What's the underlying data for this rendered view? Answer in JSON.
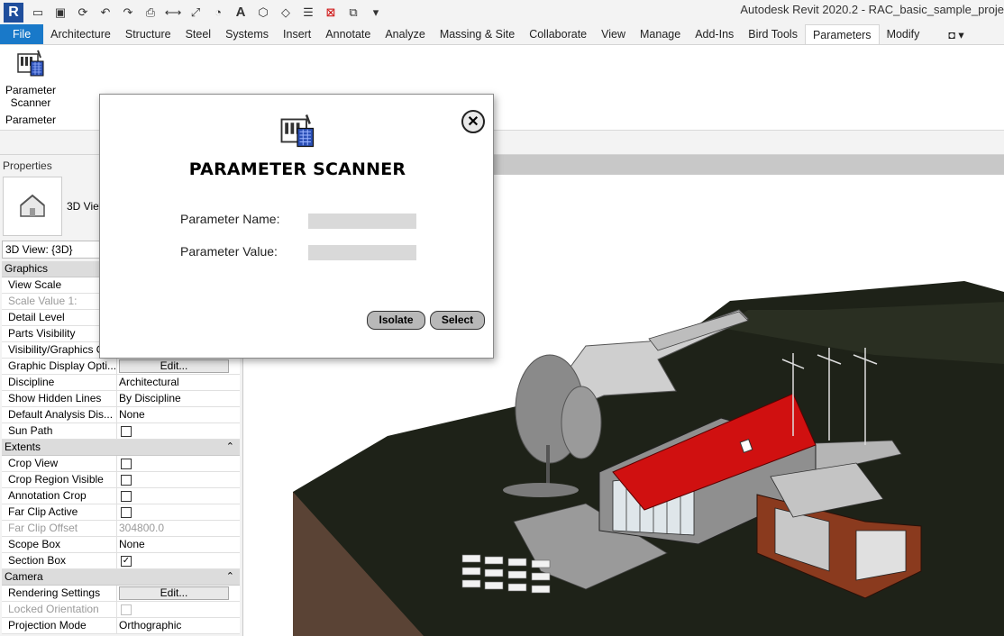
{
  "app": {
    "logo_letter": "R",
    "window_title": "Autodesk Revit 2020.2 - RAC_basic_sample_proje"
  },
  "quick_access": {
    "icons": [
      "open-icon",
      "save-icon",
      "sync-icon",
      "undo-icon",
      "redo-icon",
      "print-icon",
      "measure-icon",
      "dimension-icon",
      "tag-icon",
      "text-icon",
      "3d-view-icon",
      "section-icon",
      "thin-lines-icon",
      "close-hidden-icon",
      "switch-windows-icon",
      "customize-icon"
    ]
  },
  "ribbon_tabs": [
    "File",
    "Architecture",
    "Structure",
    "Steel",
    "Systems",
    "Insert",
    "Annotate",
    "Analyze",
    "Massing & Site",
    "Collaborate",
    "View",
    "Manage",
    "Add-Ins",
    "Bird Tools",
    "Parameters",
    "Modify"
  ],
  "active_tab": "Parameters",
  "ribbon_panel": {
    "tool_label": "Parameter Scanner",
    "panel_title": "Parameter"
  },
  "properties": {
    "title": "Properties",
    "type_name": "3D View",
    "selector": "3D View: {3D}",
    "rows": [
      {
        "kind": "group",
        "name": "Graphics",
        "collapse": ""
      },
      {
        "kind": "row",
        "name": "View Scale",
        "value": ""
      },
      {
        "kind": "row",
        "name": "Scale Value    1:",
        "value": "",
        "disabled": true
      },
      {
        "kind": "row",
        "name": "Detail Level",
        "value": ""
      },
      {
        "kind": "row",
        "name": "Parts Visibility",
        "value": ""
      },
      {
        "kind": "row",
        "name": "Visibility/Graphics O",
        "value": ""
      },
      {
        "kind": "button",
        "name": "Graphic Display Opti...",
        "value": "Edit..."
      },
      {
        "kind": "row",
        "name": "Discipline",
        "value": "Architectural"
      },
      {
        "kind": "row",
        "name": "Show Hidden Lines",
        "value": "By Discipline"
      },
      {
        "kind": "row",
        "name": "Default Analysis Dis...",
        "value": "None"
      },
      {
        "kind": "check",
        "name": "Sun Path",
        "checked": false
      },
      {
        "kind": "group",
        "name": "Extents",
        "collapse": "⌃"
      },
      {
        "kind": "check",
        "name": "Crop View",
        "checked": false
      },
      {
        "kind": "check",
        "name": "Crop Region Visible",
        "checked": false
      },
      {
        "kind": "check",
        "name": "Annotation Crop",
        "checked": false
      },
      {
        "kind": "check",
        "name": "Far Clip Active",
        "checked": false
      },
      {
        "kind": "row",
        "name": "Far Clip Offset",
        "value": "304800.0",
        "disabled": true
      },
      {
        "kind": "row",
        "name": "Scope Box",
        "value": "None"
      },
      {
        "kind": "check",
        "name": "Section Box",
        "checked": true
      },
      {
        "kind": "group",
        "name": "Camera",
        "collapse": "⌃"
      },
      {
        "kind": "button",
        "name": "Rendering Settings",
        "value": "Edit..."
      },
      {
        "kind": "check",
        "name": "Locked Orientation",
        "checked": false,
        "disabled": true
      },
      {
        "kind": "row",
        "name": "Projection Mode",
        "value": "Orthographic"
      }
    ]
  },
  "dialog": {
    "title": "PARAMETER SCANNER",
    "name_label": "Parameter Name:",
    "name_value": "",
    "value_label": "Parameter Value:",
    "value_value": "",
    "isolate_label": "Isolate",
    "select_label": "Select",
    "close_glyph": "✕"
  },
  "colors": {
    "file_tab": "#1979c9",
    "terrain": "#1e2218",
    "soil": "#5a4335",
    "roof": "#d01010",
    "wood_cladding": "#8a3a1e"
  }
}
